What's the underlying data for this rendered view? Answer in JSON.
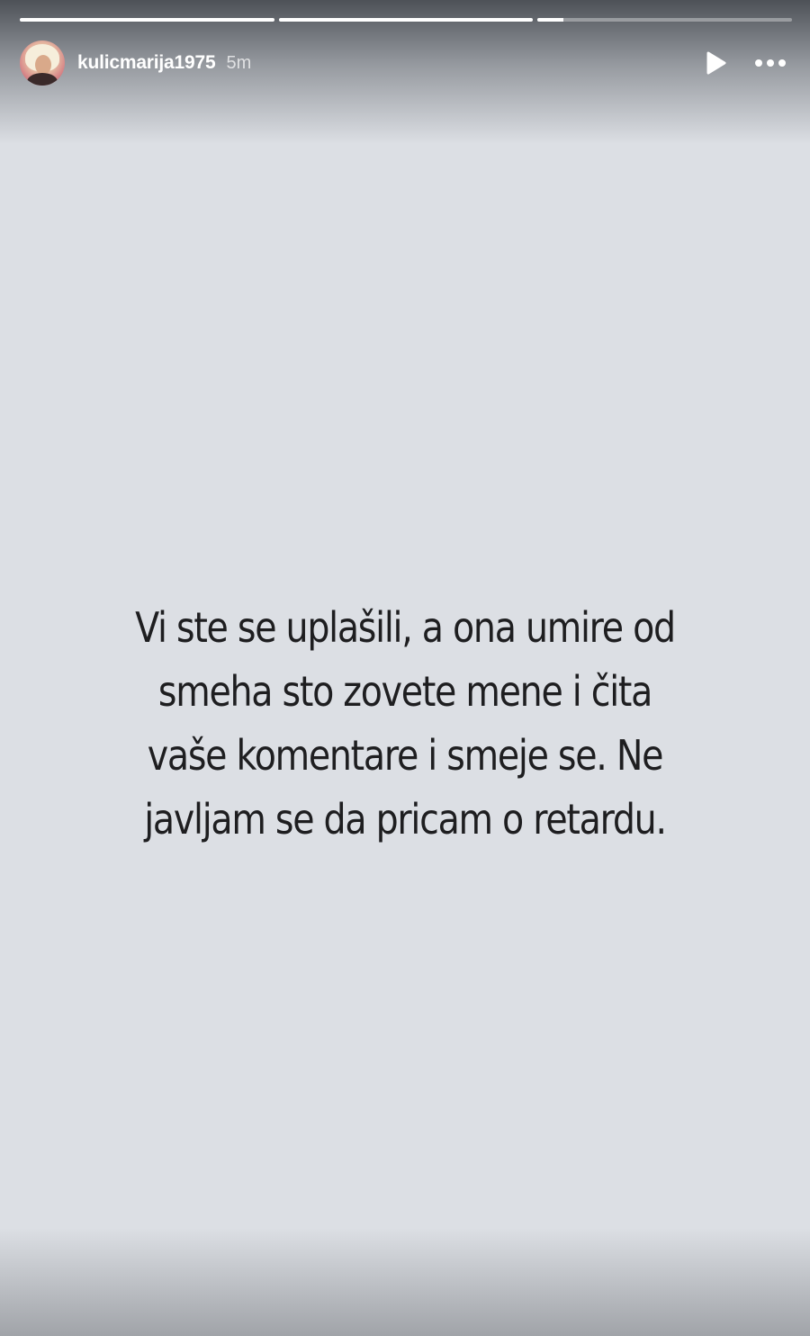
{
  "story": {
    "progress": [
      {
        "fill": 1.0
      },
      {
        "fill": 1.0
      },
      {
        "fill": 0.1
      }
    ],
    "username": "kulicmarija1975",
    "time": "5m",
    "icons": {
      "avatar": "profile-avatar",
      "play": "play-icon",
      "more": "more-icon"
    },
    "text_lines": [
      "Vi ste se uplašili, a ona umire od",
      "smeha sto zovete mene i čita",
      "vaše komentare i smeje se. Ne",
      "javljam se da pricam o retardu."
    ]
  }
}
